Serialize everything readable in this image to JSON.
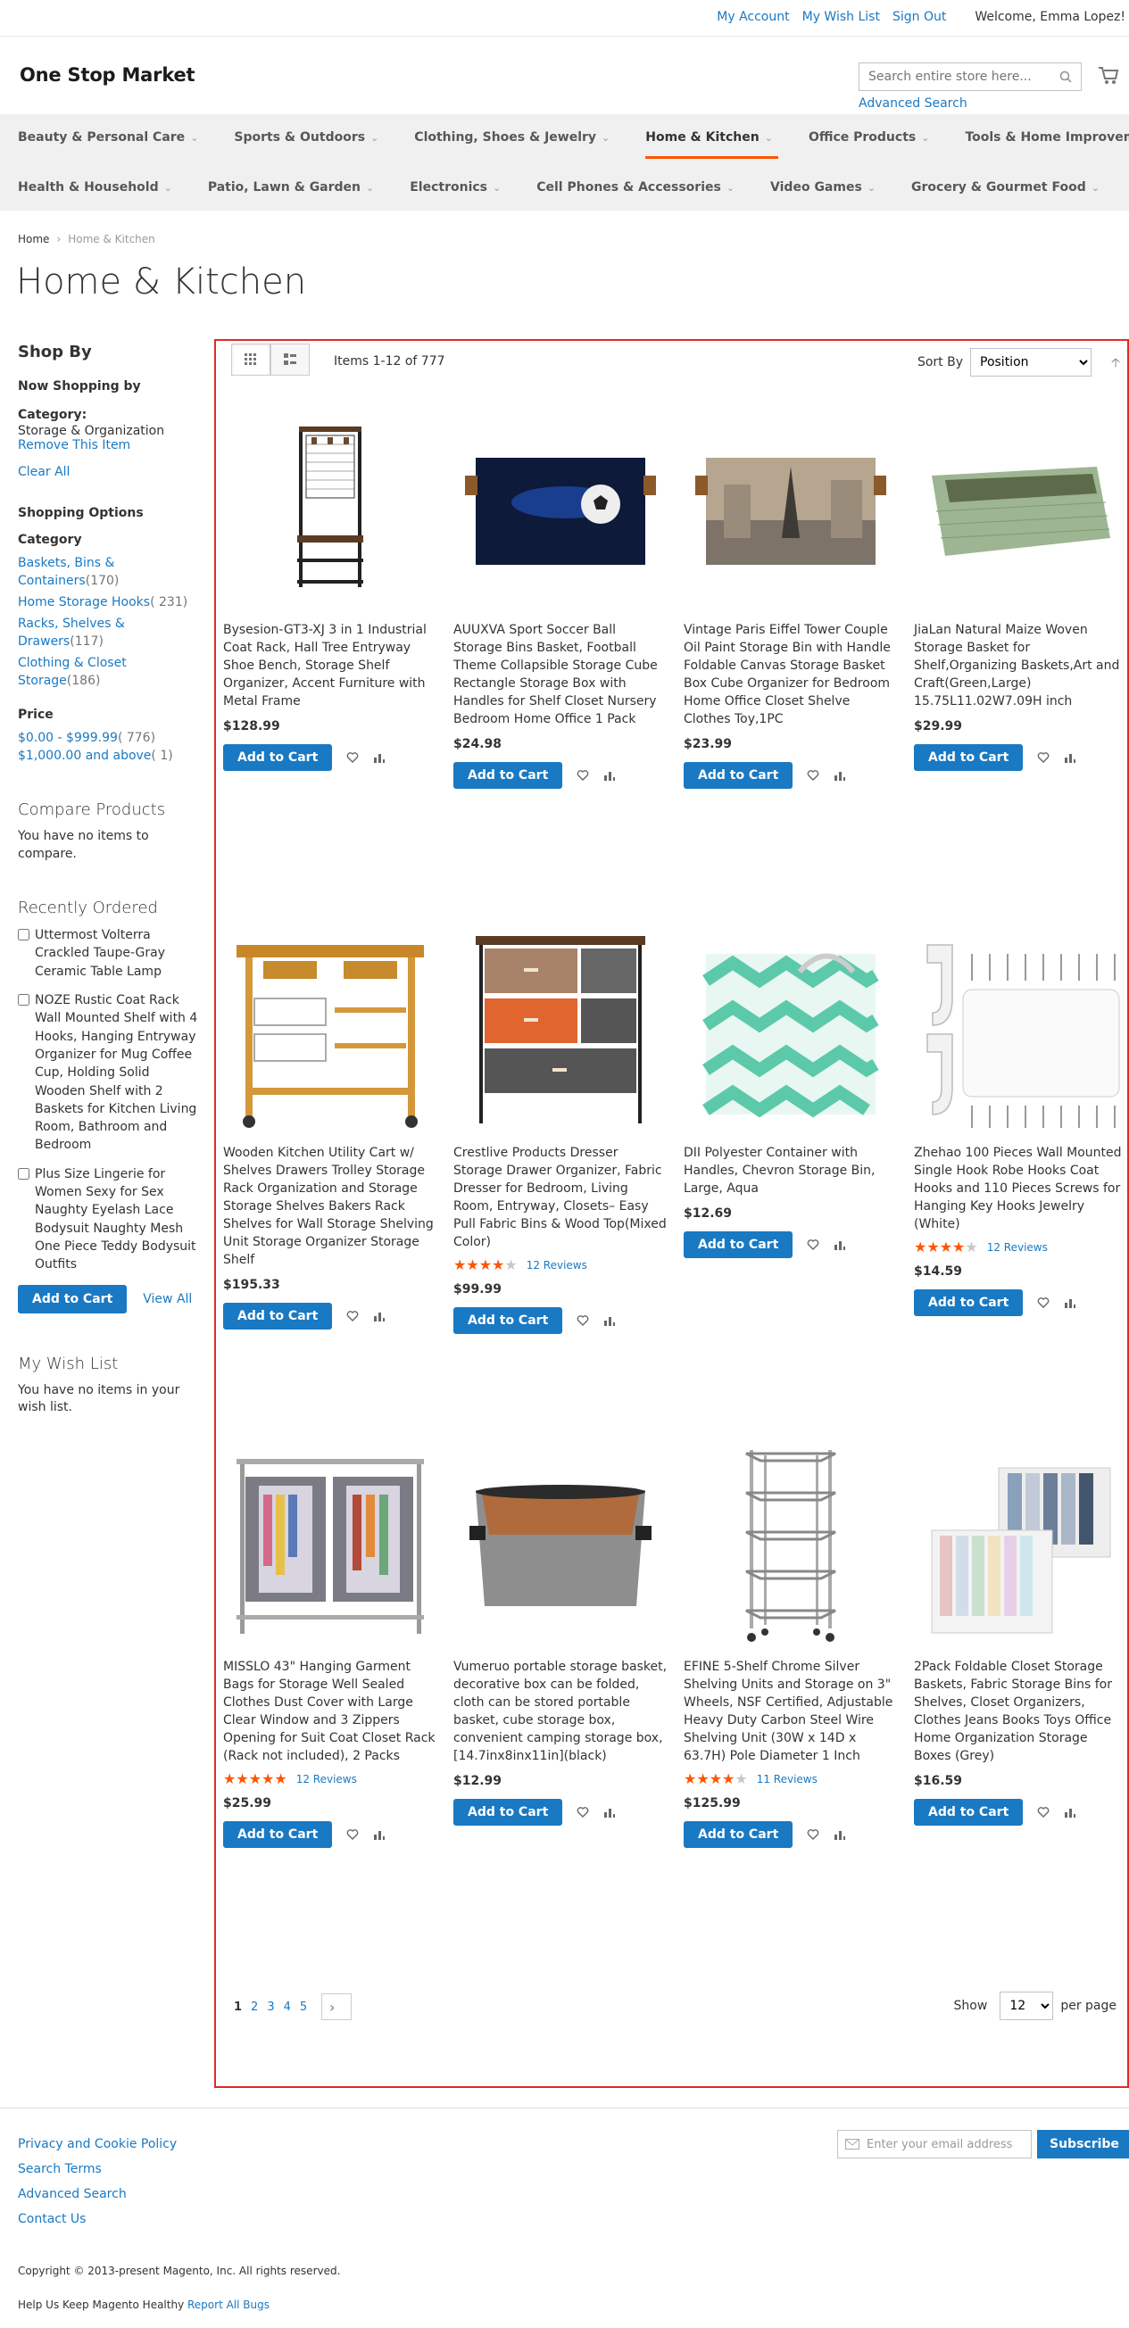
{
  "header": {
    "links": [
      "My Account",
      "My Wish List",
      "Sign Out"
    ],
    "welcome": "Welcome, Emma Lopez!",
    "logo": "One Stop Market",
    "search_placeholder": "Search entire store here...",
    "advanced_search": "Advanced Search"
  },
  "nav": {
    "row1": [
      "Beauty & Personal Care",
      "Sports & Outdoors",
      "Clothing, Shoes & Jewelry",
      "Home & Kitchen",
      "Office Products",
      "Tools & Home Improvement"
    ],
    "row2": [
      "Health & Household",
      "Patio, Lawn & Garden",
      "Electronics",
      "Cell Phones & Accessories",
      "Video Games",
      "Grocery & Gourmet Food"
    ],
    "active": "Home & Kitchen"
  },
  "breadcrumb": {
    "home": "Home",
    "current": "Home & Kitchen"
  },
  "page_title": "Home & Kitchen",
  "sidebar": {
    "shop_by": "Shop By",
    "now_shopping": "Now Shopping by",
    "filter_label": "Category:",
    "filter_value": "Storage & Organization",
    "remove": "Remove This Item",
    "clear_all": "Clear All",
    "shopping_options": "Shopping Options",
    "category_title": "Category",
    "categories": [
      {
        "name": "Baskets, Bins & Containers",
        "count": "170"
      },
      {
        "name": "Home Storage Hooks",
        "count": "231"
      },
      {
        "name": "Racks, Shelves & Drawers",
        "count": "117"
      },
      {
        "name": "Clothing & Closet Storage",
        "count": "186"
      }
    ],
    "price_title": "Price",
    "prices": [
      {
        "range": "$0.00 - $999.99",
        "count": "776"
      },
      {
        "range": "$1,000.00 and above",
        "count": "1"
      }
    ],
    "compare_title": "Compare Products",
    "compare_text": "You have no items to compare.",
    "recent_title": "Recently Ordered",
    "recent_items": [
      "Uttermost Volterra Crackled Taupe-Gray Ceramic Table Lamp",
      "NOZE Rustic Coat Rack Wall Mounted Shelf with 4 Hooks, Hanging Entryway Organizer for Mug Coffee Cup, Holding Solid Wooden Shelf with 2 Baskets for Kitchen Living Room, Bathroom and Bedroom",
      "Plus Size Lingerie for Women Sexy for Sex Naughty Eyelash Lace Bodysuit Naughty Mesh One Piece Teddy Bodysuit Outfits"
    ],
    "add_to_cart": "Add to Cart",
    "view_all": "View All",
    "wishlist_title": "My Wish List",
    "wishlist_text": "You have no items in your wish list."
  },
  "toolbar": {
    "amount": "Items 1-12 of 777",
    "sort_by": "Sort By",
    "sort_value": "Position",
    "show": "Show",
    "limit_value": "12",
    "per_page": "per page",
    "pages": [
      "1",
      "2",
      "3",
      "4",
      "5"
    ]
  },
  "products": [
    {
      "name": "Bysesion-GT3-XJ 3 in 1 Industrial Coat Rack, Hall Tree Entryway Shoe Bench, Storage Shelf Organizer, Accent Furniture with Metal Frame",
      "price": "$128.99",
      "image": "coat-rack-bench"
    },
    {
      "name": "AUUXVA Sport Soccer Ball Storage Bins Basket, Football Theme Collapsible Storage Cube Rectangle Storage Box with Handles for Shelf Closet Nursery Bedroom Home Office 1 Pack",
      "price": "$24.98",
      "image": "soccer-storage-bin"
    },
    {
      "name": "Vintage Paris Eiffel Tower Couple Oil Paint Storage Bin with Handle Foldable Canvas Storage Basket Box Cube Organizer for Bedroom Home Office Closet Shelve Clothes Toy,1PC",
      "price": "$23.99",
      "image": "paris-storage-bin"
    },
    {
      "name": "JiaLan Natural Maize Woven Storage Basket for Shelf,Organizing Baskets,Art and Craft(Green,Large) 15.75L11.02W7.09H inch",
      "price": "$29.99",
      "image": "woven-basket"
    },
    {
      "name": "Wooden Kitchen Utility Cart w/ Shelves Drawers Trolley Storage Rack Organization and Storage Storage Shelves Bakers Rack Shelves for Wall Storage Shelving Unit Storage Organizer Storage Shelf",
      "price": "$195.33",
      "image": "kitchen-cart"
    },
    {
      "name": "Crestlive Products Dresser Storage Drawer Organizer, Fabric Dresser for Bedroom, Living Room, Entryway, Closets– Easy Pull Fabric Bins & Wood Top(Mixed Color)",
      "price": "$99.99",
      "rating": 4,
      "reviews": "12  Reviews",
      "image": "fabric-dresser"
    },
    {
      "name": "DII Polyester Container with Handles, Chevron Storage Bin, Large, Aqua",
      "price": "$12.69",
      "image": "chevron-bin"
    },
    {
      "name": "Zhehao 100 Pieces Wall Mounted Single Hook Robe Hooks Coat Hooks and 110 Pieces Screws for Hanging Key Hooks Jewelry (White)",
      "price": "$14.59",
      "rating": 4,
      "reviews": "12  Reviews",
      "image": "wall-hooks"
    },
    {
      "name": "MISSLO 43\" Hanging Garment Bags for Storage Well Sealed Clothes Dust Cover with Large Clear Window and 3 Zippers Opening for Suit Coat Closet Rack (Rack not included), 2 Packs",
      "price": "$25.99",
      "rating": 5,
      "reviews": "12  Reviews",
      "image": "garment-bags"
    },
    {
      "name": "Vumeruo portable storage basket, decorative box can be folded, cloth can be stored portable basket, cube storage box, convenient camping storage box, [14.7inx8inx11in](black)",
      "price": "$12.99",
      "image": "gray-basket"
    },
    {
      "name": "EFINE 5-Shelf Chrome Silver Shelving Units and Storage on 3\" Wheels, NSF Certified, Adjustable Heavy Duty Carbon Steel Wire Shelving Unit (30W x 14D x 63.7H) Pole Diameter 1 Inch",
      "price": "$125.99",
      "rating": 4,
      "reviews": "11  Reviews",
      "image": "wire-shelving"
    },
    {
      "name": "2Pack Foldable Closet Storage Baskets, Fabric Storage Bins for Shelves, Closet Organizers, Clothes Jeans Books Toys Office Home Organization Storage Boxes (Grey)",
      "price": "$16.59",
      "image": "closet-bins"
    }
  ],
  "footer": {
    "links": [
      "Privacy and Cookie Policy",
      "Search Terms",
      "Advanced Search",
      "Contact Us"
    ],
    "newsletter_placeholder": "Enter your email address",
    "subscribe": "Subscribe",
    "copyright": "Copyright © 2013-present Magento, Inc. All rights reserved.",
    "bugs_text": "Help Us Keep Magento Healthy",
    "bugs_link": "Report All Bugs"
  },
  "colors": {
    "accent": "#1979c3",
    "nav_active": "#ff5501",
    "highlight_border": "#e02b27",
    "star": "#ff5501"
  }
}
